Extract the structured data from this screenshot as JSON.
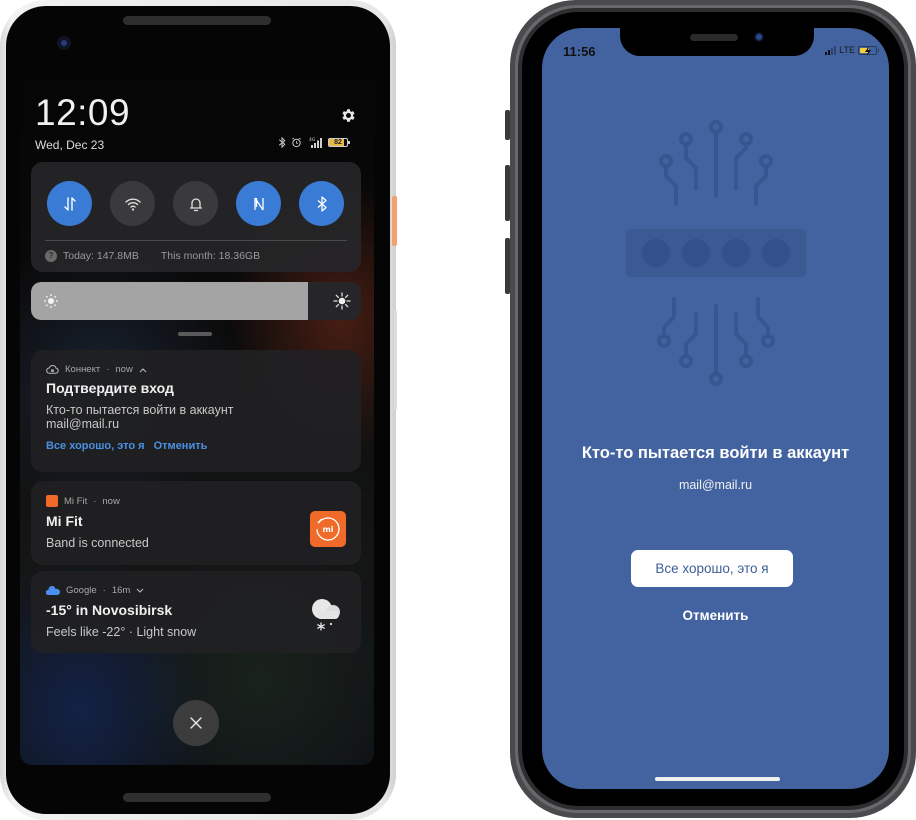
{
  "android": {
    "clock": "12:09",
    "date": "Wed, Dec 23",
    "status": {
      "icons": [
        "bluetooth-icon",
        "alarm-icon",
        "signal-4g-icon",
        "battery-icon"
      ],
      "network_label": "4G",
      "battery_percent": 82,
      "battery_label": "82"
    },
    "quick_settings": {
      "toggles": [
        {
          "name": "mobile-data",
          "icon": "data-arrows-icon",
          "on": true
        },
        {
          "name": "wifi",
          "icon": "wifi-icon",
          "on": false
        },
        {
          "name": "sound",
          "icon": "bell-icon",
          "on": false
        },
        {
          "name": "nfc",
          "icon": "nfc-icon",
          "on": true
        },
        {
          "name": "bluetooth",
          "icon": "bluetooth-icon",
          "on": true
        }
      ],
      "accent_color": "#3a7bd5",
      "data_usage_today": "Today: 147.8MB",
      "data_usage_month": "This month: 18.36GB"
    },
    "brightness": {
      "level_percent": 84
    },
    "notifications": [
      {
        "app": "Коннект",
        "time": "now",
        "title": "Подтвердите вход",
        "body_line1": "Кто-то пытается войти в аккаунт",
        "body_line2": "mail@mail.ru",
        "actions": [
          "Все хорошо, это я",
          "Отменить"
        ],
        "action_color": "#4a90e2"
      },
      {
        "app": "Mi Fit",
        "time": "now",
        "title": "Mi Fit",
        "body": "Band is connected",
        "icon_label": "mi",
        "brand_color": "#f06a2a"
      },
      {
        "app": "Google",
        "time": "16m",
        "title": "-15° in Novosibirsk",
        "body": "Feels like -22° · Light snow",
        "icon": "snow-cloud-icon"
      }
    ],
    "dismiss_icon": "close-icon"
  },
  "iphone": {
    "time": "11:56",
    "network": "LTE",
    "signal_bars": 2,
    "battery_charging": true,
    "background_color": "#4363a0",
    "title": "Кто-то пытается войти в аккаунт",
    "email": "mail@mail.ru",
    "confirm_label": "Все хорошо, это я",
    "cancel_label": "Отменить"
  }
}
